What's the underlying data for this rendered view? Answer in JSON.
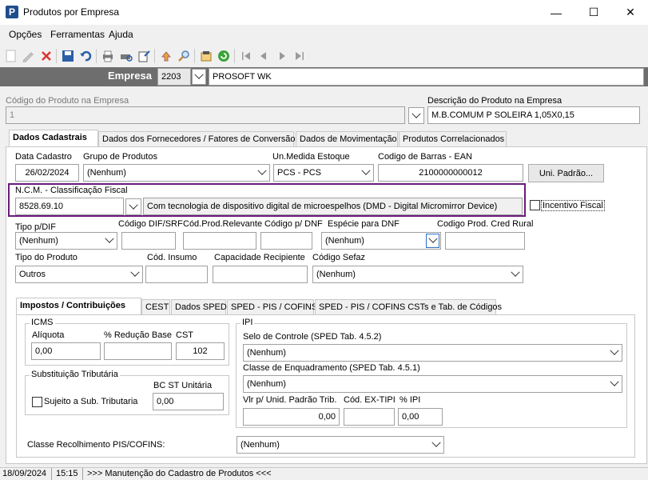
{
  "window": {
    "title": "Produtos por Empresa",
    "minimize": "—",
    "maximize": "☐",
    "close": "✕"
  },
  "menu": [
    "Opções",
    "Ferramentas",
    "Ajuda"
  ],
  "toolbar": {
    "icons": [
      "new-doc-icon",
      "edit-icon",
      "delete-icon",
      "save-icon",
      "undo-icon",
      "print-icon",
      "print-preview-icon",
      "export-icon",
      "lookup-icon",
      "search-icon",
      "report-icon",
      "refresh-icon",
      "first-record-icon",
      "prev-record-icon",
      "next-record-icon",
      "last-record-icon"
    ]
  },
  "empresa": {
    "label": "Empresa",
    "code": "2203",
    "name": "PROSOFT WK"
  },
  "produto": {
    "codigo_label": "Código do Produto na Empresa",
    "codigo_value": "1",
    "descricao_label": "Descrição do Produto na Empresa",
    "descricao_value": "M.B.COMUM P SOLEIRA 1,05X0,15"
  },
  "main_tabs": [
    "Dados Cadastrais",
    "Dados dos Fornecedores / Fatores de Conversão",
    "Dados de Movimentação",
    "Produtos Correlacionados"
  ],
  "dados": {
    "data_cadastro_label": "Data Cadastro",
    "data_cadastro": "26/02/2024",
    "grupo_label": "Grupo de Produtos",
    "grupo": "(Nenhum)",
    "unmedida_label": "Un.Medida Estoque",
    "unmedida": "PCS - PCS",
    "ean_label": "Codigo de Barras - EAN",
    "ean": "2100000000012",
    "uni_padrao_button": "Uni. Padrão...",
    "ncm_label": "N.C.M. - Classificação Fiscal",
    "ncm": "8528.69.10",
    "ncm_desc": "Com tecnologia de dispositivo digital de microespelhos (DMD - Digital Micromirror Device)",
    "incentivo_label": "Incentivo Fiscal",
    "tipo_dif_label": "Tipo p/DIF",
    "tipo_dif": "(Nenhum)",
    "cod_dif_label": "Código DIF/SRF",
    "cod_relevante_label": "Cód.Prod.Relevante",
    "cod_dnf_label": "Código p/ DNF",
    "especie_dnf_label": "Espécie para DNF",
    "especie_dnf": "(Nenhum)",
    "cod_cred_rural_label": "Codigo Prod. Cred Rural",
    "tipo_produto_label": "Tipo do Produto",
    "tipo_produto": "Outros",
    "cod_insumo_label": "Cód. Insumo",
    "capacidade_label": "Capacidade Recipiente",
    "sefaz_label": "Código Sefaz",
    "sefaz": "(Nenhum)"
  },
  "sub_tabs": [
    "Impostos / Contribuições",
    "CEST",
    "Dados SPED",
    "SPED - PIS / COFINS",
    "SPED - PIS / COFINS CSTs e Tab. de Códigos"
  ],
  "icms": {
    "title": "ICMS",
    "aliquota_label": "Alíquota",
    "aliquota": "0,00",
    "reducao_label": "% Redução Base",
    "reducao": "",
    "cst_label": "CST",
    "cst": "102"
  },
  "st": {
    "title": "Substituição Tributária",
    "bc_label": "BC ST Unitária",
    "bc": "0,00",
    "sujeito_label": "Sujeito a Sub. Tributaria"
  },
  "ipi": {
    "title": "IPI",
    "selo_label": "Selo de Controle (SPED Tab. 4.5.2)",
    "selo": "(Nenhum)",
    "classe_label": "Classe de Enquadramento (SPED Tab. 4.5.1)",
    "classe": "(Nenhum)",
    "vlr_label": "Vlr p/ Unid. Padrão Trib.",
    "vlr": "0,00",
    "ex_tipi_label": "Cód. EX-TIPI",
    "ex_tipi": "",
    "pct_ipi_label": "% IPI",
    "pct_ipi": "0,00"
  },
  "classe_pis": {
    "label": "Classe Recolhimento PIS/COFINS:",
    "value": "(Nenhum)"
  },
  "status": {
    "date": "18/09/2024",
    "time": "15:15",
    "message": ">>> Manutenção do Cadastro de Produtos <<<"
  },
  "colors": {
    "highlight": "#6a1b7a",
    "empresa_bar": "#6e6e6e"
  }
}
